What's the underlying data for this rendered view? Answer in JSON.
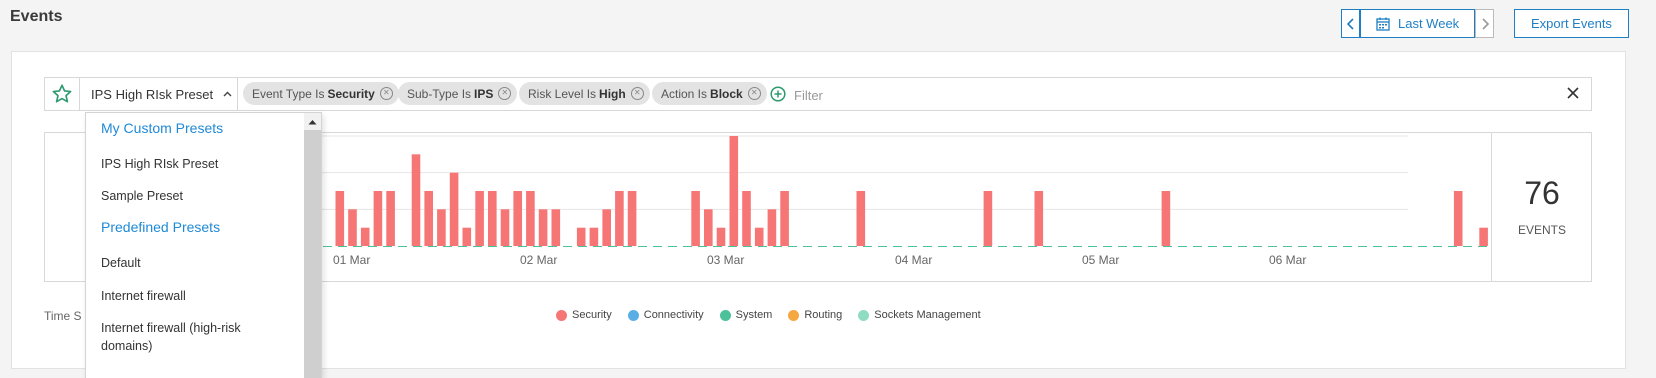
{
  "page": {
    "title": "Events"
  },
  "date_range": {
    "label": "Last Week",
    "prev_icon": "chevron-left-icon",
    "next_icon": "chevron-right-icon",
    "calendar_icon": "calendar-icon"
  },
  "export_button": {
    "label": "Export Events"
  },
  "filter_bar": {
    "preset_selected": "IPS High RIsk Preset",
    "chips": [
      {
        "field": "Event Type Is",
        "value": "Security"
      },
      {
        "field": "Sub-Type Is",
        "value": "IPS"
      },
      {
        "field": "Risk Level Is",
        "value": "High"
      },
      {
        "field": "Action Is",
        "value": "Block"
      }
    ],
    "placeholder": "Filter"
  },
  "preset_dropdown": {
    "custom_header": "My Custom Presets",
    "custom_items": [
      "IPS High RIsk Preset",
      "Sample Preset"
    ],
    "predefined_header": "Predefined Presets",
    "predefined_items": [
      "Default",
      "Internet firewall",
      "Internet firewall (high-risk domains)"
    ]
  },
  "events_summary": {
    "count": "76",
    "label": "EVENTS"
  },
  "timeseries_label": "Time S",
  "colors": {
    "security": "#f67676",
    "connectivity": "#5aaee6",
    "system": "#4dc19a",
    "routing": "#f5a742",
    "sockets": "#8fdcc2",
    "accent": "#1f7fc4"
  },
  "chart_data": {
    "type": "bar",
    "x_tick_labels": [
      "01 Mar",
      "02 Mar",
      "03 Mar",
      "04 Mar",
      "05 Mar",
      "06 Mar"
    ],
    "legend": [
      {
        "name": "Security",
        "color": "#f67676"
      },
      {
        "name": "Connectivity",
        "color": "#5aaee6"
      },
      {
        "name": "System",
        "color": "#4dc19a"
      },
      {
        "name": "Routing",
        "color": "#f5a742"
      },
      {
        "name": "Sockets Management",
        "color": "#8fdcc2"
      }
    ],
    "grid": true,
    "ylim": [
      0,
      6
    ],
    "series": [
      {
        "name": "Security",
        "values": [
          3,
          0,
          3,
          2,
          1,
          3,
          3,
          0,
          5,
          3,
          2,
          4,
          1,
          3,
          3,
          2,
          3,
          3,
          2,
          2,
          0,
          1,
          1,
          2,
          3,
          3,
          0,
          0,
          0,
          0,
          3,
          2,
          1,
          6,
          3,
          1,
          2,
          3,
          0,
          0,
          0,
          0,
          0,
          3,
          0,
          0,
          0,
          0,
          0,
          0,
          0,
          0,
          0,
          3,
          0,
          0,
          0,
          3,
          0,
          0,
          0,
          0,
          0,
          0,
          0,
          0,
          0,
          3,
          0,
          0,
          0,
          0,
          0,
          0,
          0,
          0,
          0,
          0,
          0,
          0,
          0,
          0,
          0,
          0,
          0,
          0,
          0,
          0,
          0,
          0,
          3,
          0,
          1
        ]
      }
    ]
  }
}
